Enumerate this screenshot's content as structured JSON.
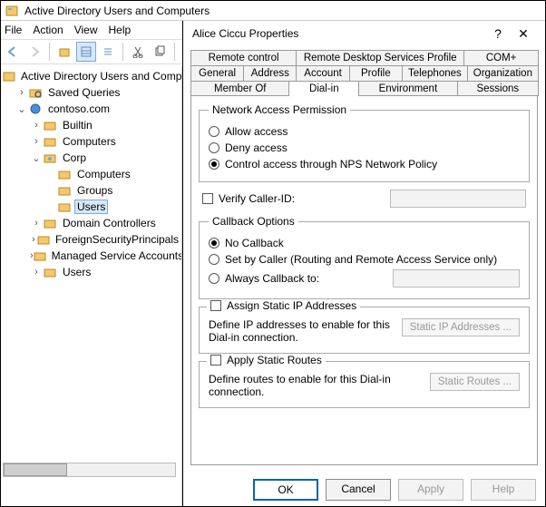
{
  "window": {
    "title": "Active Directory Users and Computers"
  },
  "menu": {
    "file": "File",
    "action": "Action",
    "view": "View",
    "help": "Help"
  },
  "tree": {
    "root": "Active Directory Users and Computers",
    "saved": "Saved Queries",
    "domain": "contoso.com",
    "builtin": "Builtin",
    "computers": "Computers",
    "corp": "Corp",
    "corp_computers": "Computers",
    "corp_groups": "Groups",
    "corp_users": "Users",
    "dc": "Domain Controllers",
    "fsp": "ForeignSecurityPrincipals",
    "msa": "Managed Service Accounts",
    "users": "Users"
  },
  "dialog": {
    "title": "Alice Ciccu Properties",
    "tabs_row1": {
      "remote": "Remote control",
      "rds": "Remote Desktop Services Profile",
      "com": "COM+"
    },
    "tabs_row2": {
      "general": "General",
      "address": "Address",
      "account": "Account",
      "profile": "Profile",
      "tel": "Telephones",
      "org": "Organization"
    },
    "tabs_row3": {
      "member": "Member Of",
      "dialin": "Dial-in",
      "env": "Environment",
      "sessions": "Sessions"
    },
    "nap": {
      "legend": "Network Access Permission",
      "allow": "Allow access",
      "deny": "Deny access",
      "nps": "Control access through NPS Network Policy"
    },
    "verify": "Verify Caller-ID:",
    "callback": {
      "legend": "Callback Options",
      "none": "No Callback",
      "caller": "Set by Caller (Routing and Remote Access Service only)",
      "always": "Always Callback to:"
    },
    "static_ip": {
      "head": "Assign Static IP Addresses",
      "hint": "Define IP addresses to enable for this Dial-in connection.",
      "btn": "Static IP Addresses ..."
    },
    "static_routes": {
      "head": "Apply Static Routes",
      "hint": "Define routes to enable for this Dial-in connection.",
      "btn": "Static Routes ..."
    },
    "buttons": {
      "ok": "OK",
      "cancel": "Cancel",
      "apply": "Apply",
      "help": "Help"
    }
  }
}
